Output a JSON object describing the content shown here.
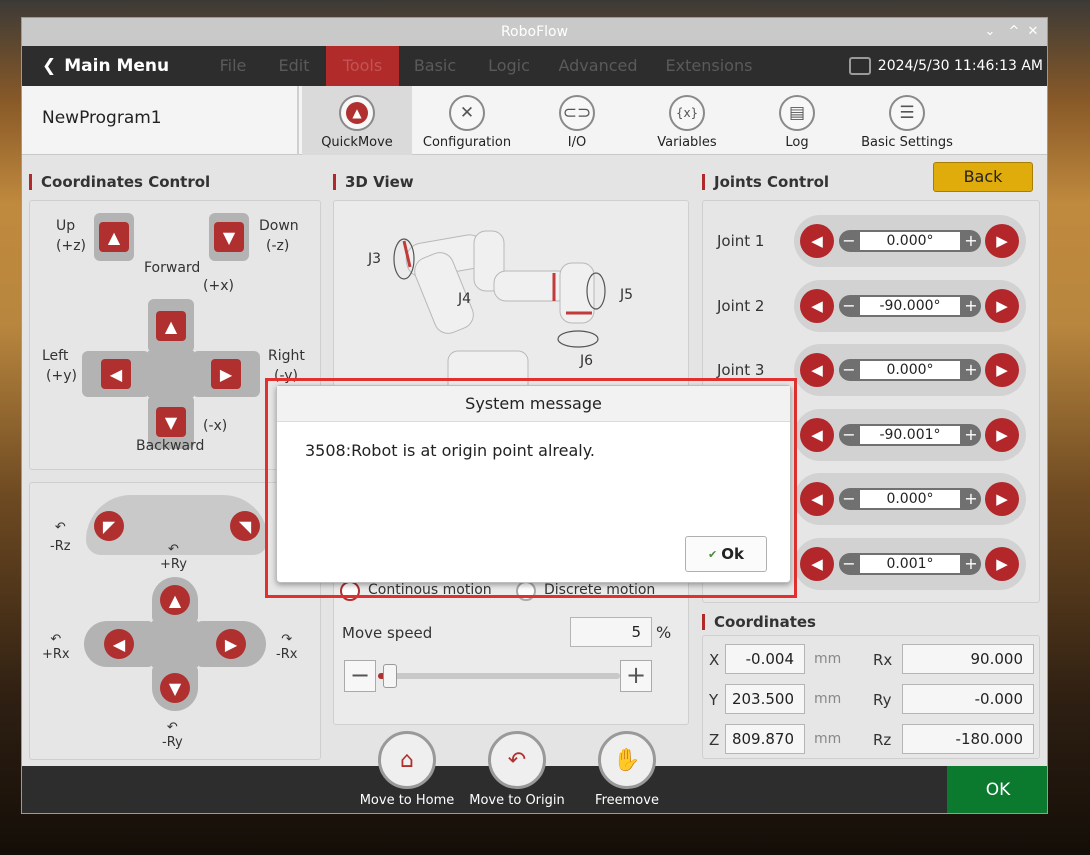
{
  "window": {
    "title": "RoboFlow",
    "controls": [
      "⌄",
      "^",
      "✕"
    ]
  },
  "menubar": {
    "main_menu": "Main Menu",
    "items": [
      "File",
      "Edit",
      "Tools",
      "Basic",
      "Logic",
      "Advanced",
      "Extensions"
    ],
    "active": "Tools",
    "datetime": "2024/5/30 11:46:13 AM"
  },
  "toolbar": {
    "program_name": "NewProgram1",
    "tools": [
      {
        "label": "QuickMove",
        "icon": "quickmove-icon"
      },
      {
        "label": "Configuration",
        "icon": "wrench-screwdriver-icon"
      },
      {
        "label": "I/O",
        "icon": "link-icon"
      },
      {
        "label": "Variables",
        "icon": "variables-icon"
      },
      {
        "label": "Log",
        "icon": "log-icon"
      },
      {
        "label": "Basic Settings",
        "icon": "sliders-icon"
      }
    ],
    "active_tool": "QuickMove"
  },
  "coordinates_control": {
    "title": "Coordinates Control",
    "up": "Up",
    "up_axis": "(+z)",
    "down": "Down",
    "down_axis": "(-z)",
    "forward": "Forward",
    "forward_axis": "(+x)",
    "left": "Left",
    "left_axis": "(+y)",
    "right": "Right",
    "right_axis": "(-y)",
    "backward": "Backward",
    "backward_axis": "(-x)",
    "rz_minus": "-Rz",
    "ry_plus": "+Ry",
    "rx_plus": "+Rx",
    "rx_minus": "-Rx",
    "ry_minus": "-Ry"
  },
  "view3d": {
    "title": "3D View",
    "labels": [
      "J3",
      "J4",
      "J5",
      "J6"
    ],
    "motion_continuous": "Continous motion",
    "motion_discrete": "Discrete motion",
    "speed_label": "Move speed",
    "speed_value": "5",
    "speed_unit": "%",
    "speed_fraction": 0.05
  },
  "joints_control": {
    "title": "Joints Control",
    "back": "Back",
    "joints": [
      {
        "name": "Joint 1",
        "value": "0.000°"
      },
      {
        "name": "Joint 2",
        "value": "-90.000°"
      },
      {
        "name": "Joint 3",
        "value": "0.000°"
      },
      {
        "name": "",
        "value": "-90.001°"
      },
      {
        "name": "",
        "value": "0.000°"
      },
      {
        "name": "",
        "value": "0.001°"
      }
    ]
  },
  "coordinates": {
    "title": "Coordinates",
    "unit": "mm",
    "x_label": "X",
    "x": "-0.004",
    "y_label": "Y",
    "y": "203.500",
    "z_label": "Z",
    "z": "809.870",
    "rx_label": "Rx",
    "rx": "90.000",
    "ry_label": "Ry",
    "ry": "-0.000",
    "rz_label": "Rz",
    "rz": "-180.000"
  },
  "bottom": {
    "move_home": "Move to Home",
    "move_origin": "Move to Origin",
    "freemove": "Freemove",
    "ok": "OK"
  },
  "dialog": {
    "title": "System message",
    "message": "3508:Robot is at origin point alrealy.",
    "ok": "Ok"
  },
  "colors": {
    "accent_red": "#b3262a",
    "menubar": "#2d2d2d",
    "ok_green": "#0b7a2f",
    "back_yellow": "#e0ac0b",
    "highlight": "#e23030"
  }
}
